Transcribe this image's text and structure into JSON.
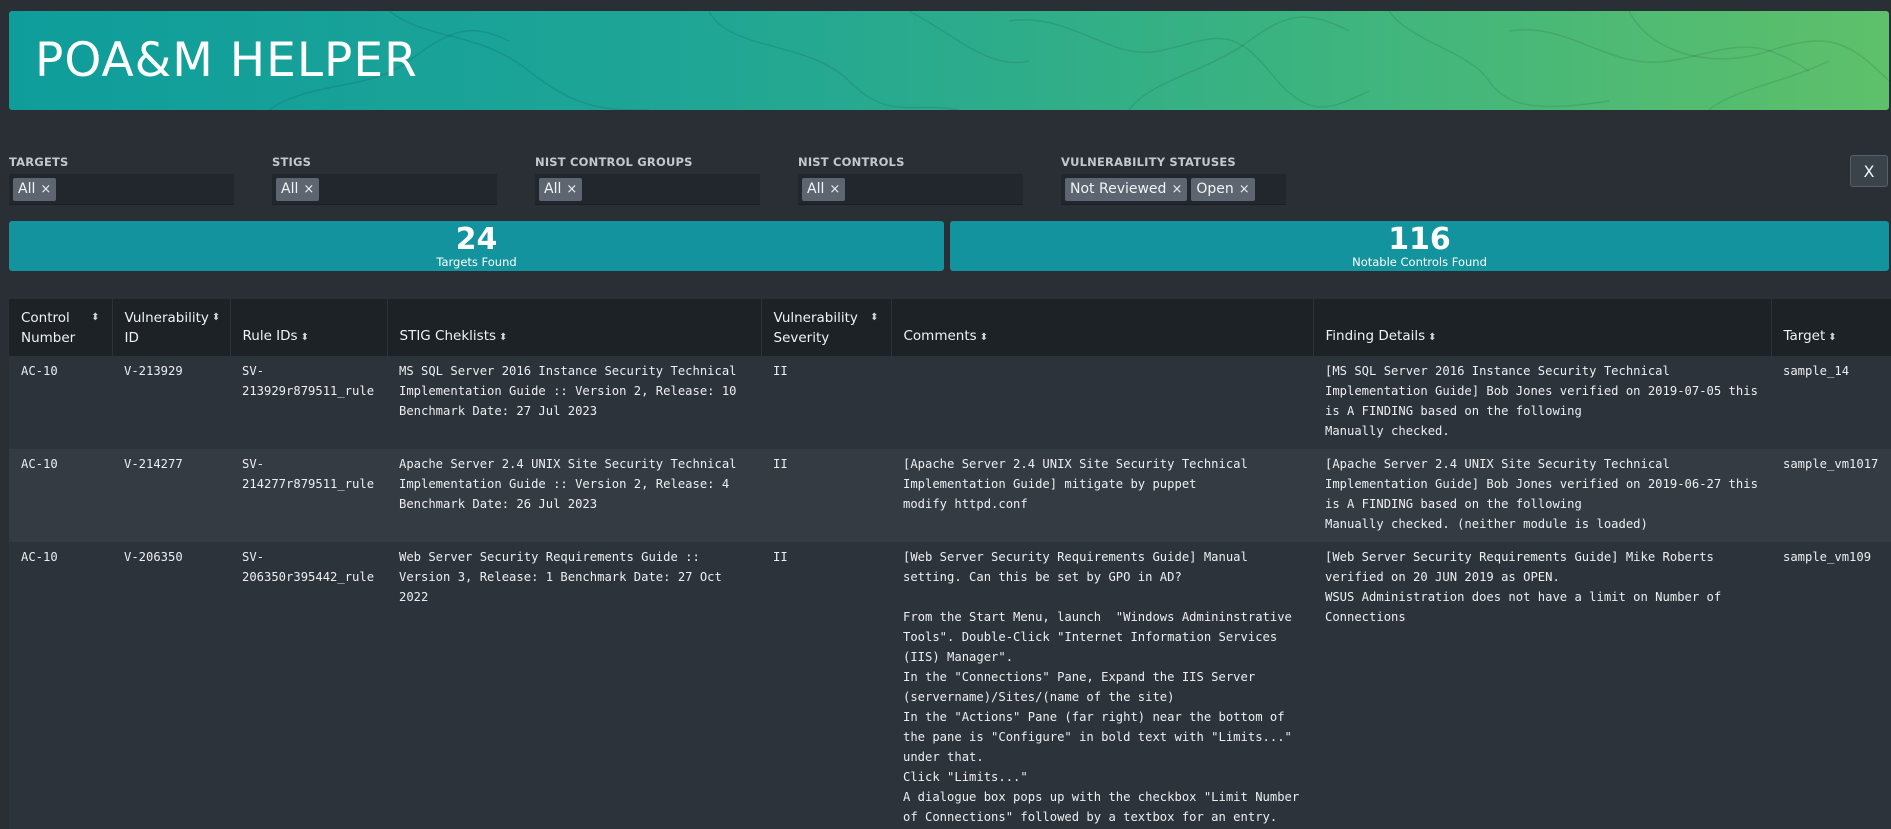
{
  "app": {
    "title": "POA&M HELPER"
  },
  "filters": [
    {
      "label": "TARGETS",
      "chips": [
        "All"
      ]
    },
    {
      "label": "STIGS",
      "chips": [
        "All"
      ]
    },
    {
      "label": "NIST CONTROL GROUPS",
      "chips": [
        "All"
      ]
    },
    {
      "label": "NIST CONTROLS",
      "chips": [
        "All"
      ]
    },
    {
      "label": "VULNERABILITY STATUSES",
      "chips": [
        "Not Reviewed",
        "Open"
      ]
    }
  ],
  "clear_label": "X",
  "chip_remove_glyph": "×",
  "stats": {
    "targets": {
      "value": "24",
      "label": "Targets Found"
    },
    "controls": {
      "value": "116",
      "label": "Notable Controls Found"
    }
  },
  "table": {
    "sort_glyph": "⬍",
    "columns": [
      "Control Number",
      "Vulnerability ID",
      "Rule IDs",
      "STIG Cheklists",
      "Vulnerability Severity",
      "Comments",
      "Finding Details",
      "Target"
    ],
    "rows": [
      {
        "control": "AC-10",
        "vuln_id": "V-213929",
        "rule_ids": "SV-213929r879511_rule",
        "stig": "MS SQL Server 2016 Instance Security Technical Implementation Guide :: Version 2, Release: 10 Benchmark Date: 27 Jul 2023",
        "severity": "II",
        "comments": "",
        "finding": "[MS SQL Server 2016 Instance Security Technical Implementation Guide] Bob Jones verified on 2019-07-05 this is A FINDING based on the following\nManually checked.",
        "target": "sample_14"
      },
      {
        "control": "AC-10",
        "vuln_id": "V-214277",
        "rule_ids": "SV-214277r879511_rule",
        "stig": "Apache Server 2.4 UNIX Site Security Technical Implementation Guide :: Version 2, Release: 4 Benchmark Date: 26 Jul 2023",
        "severity": "II",
        "comments": "[Apache Server 2.4 UNIX Site Security Technical Implementation Guide] mitigate by puppet\nmodify httpd.conf",
        "finding": "[Apache Server 2.4 UNIX Site Security Technical Implementation Guide] Bob Jones verified on 2019-06-27 this is A FINDING based on the following\nManually checked. (neither module is loaded)",
        "target": "sample_vm1017"
      },
      {
        "control": "AC-10",
        "vuln_id": "V-206350",
        "rule_ids": "SV-206350r395442_rule",
        "stig": "Web Server Security Requirements Guide :: Version 3, Release: 1 Benchmark Date: 27 Oct 2022",
        "severity": "II",
        "comments": "[Web Server Security Requirements Guide] Manual setting. Can this be set by GPO in AD?\n\nFrom the Start Menu, launch  \"Windows Admininstrative Tools\". Double-Click \"Internet Information Services (IIS) Manager\".\nIn the \"Connections\" Pane, Expand the IIS Server (servername)/Sites/(name of the site)\nIn the \"Actions\" Pane (far right) near the bottom of the pane is \"Configure\" in bold text with \"Limits...\" under that.\nClick \"Limits...\"\nA dialogue box pops up with the checkbox \"Limit Number of Connections\" followed by a textbox for an entry.",
        "finding": "[Web Server Security Requirements Guide] Mike Roberts verified on 20 JUN 2019 as OPEN.\nWSUS Administration does not have a limit on Number of Connections",
        "target": "sample_vm109"
      }
    ]
  }
}
